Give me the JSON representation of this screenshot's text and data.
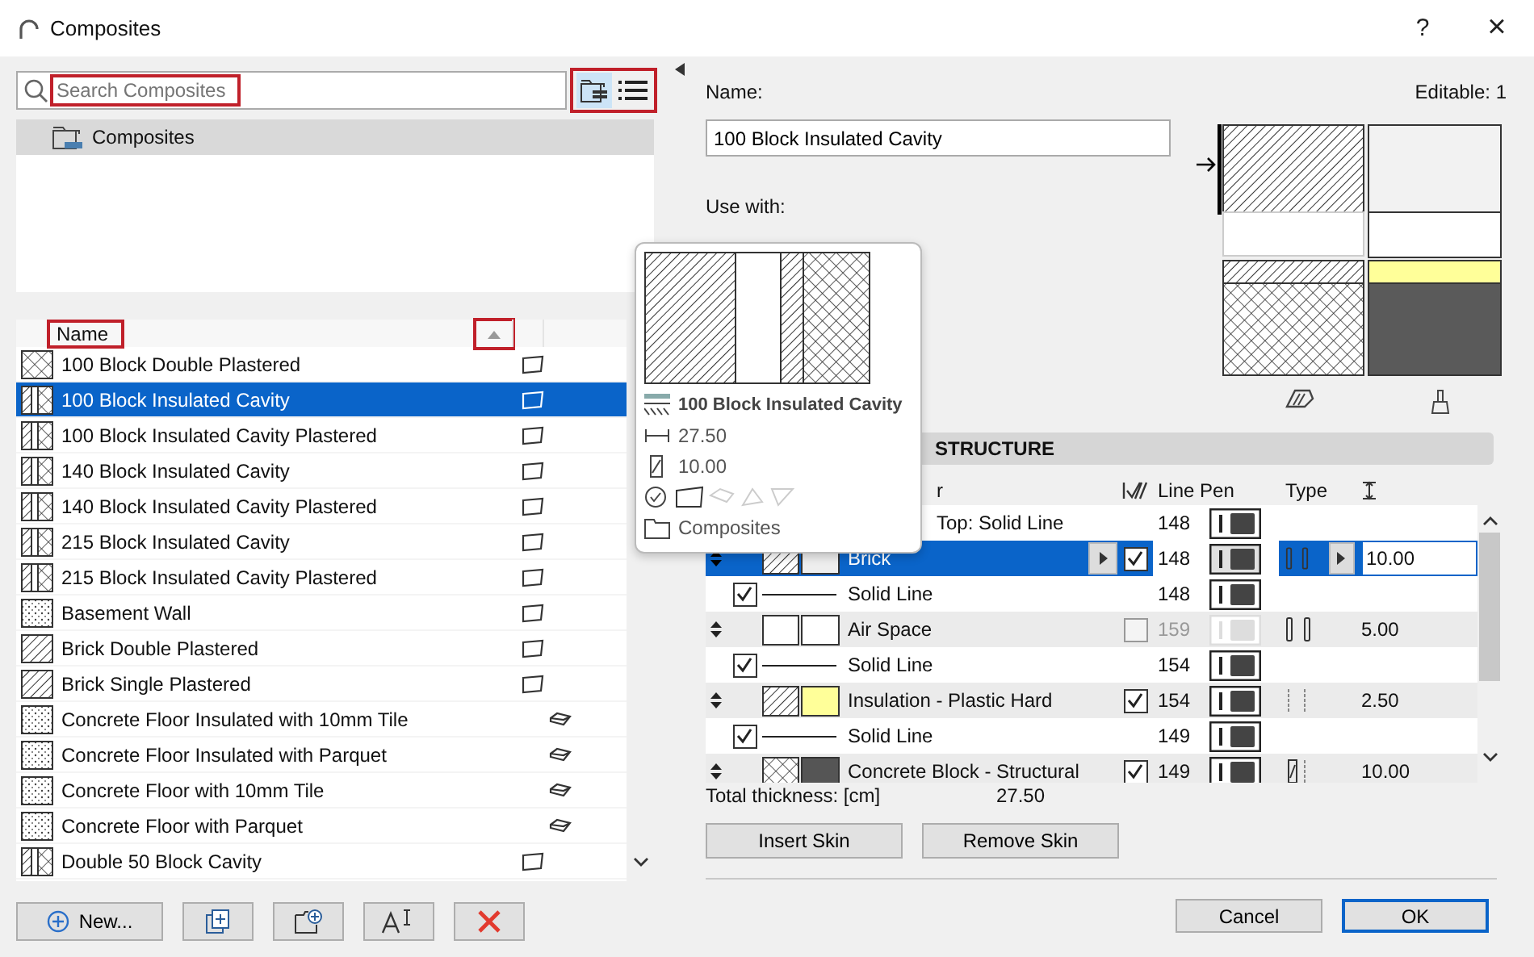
{
  "window": {
    "title": "Composites",
    "help": "?",
    "close": "×"
  },
  "search": {
    "placeholder": "Search Composites",
    "highlighted": true
  },
  "view_buttons": {
    "highlighted": true,
    "buttons": [
      {
        "kind": "folders",
        "selected": true
      },
      {
        "kind": "list",
        "selected": false
      }
    ]
  },
  "folder_tree": [
    {
      "label": "Composites",
      "selected": true
    }
  ],
  "list": {
    "name_header": {
      "label": "Name",
      "highlighted": true
    },
    "sort_button": {
      "highlighted": true
    },
    "rows": [
      {
        "name": "100 Block Double Plastered",
        "icon": {
          "kind": "cross"
        },
        "use": {
          "kind": "wall"
        },
        "selected": false
      },
      {
        "name": "100 Block Insulated Cavity",
        "icon": {
          "kind": "cavity"
        },
        "use": {
          "kind": "wall"
        },
        "selected": true
      },
      {
        "name": "100 Block Insulated Cavity Plastered",
        "icon": {
          "kind": "cavity"
        },
        "use": {
          "kind": "wall"
        },
        "selected": false
      },
      {
        "name": "140 Block Insulated Cavity",
        "icon": {
          "kind": "cavity"
        },
        "use": {
          "kind": "wall"
        },
        "selected": false
      },
      {
        "name": "140 Block Insulated Cavity Plastered",
        "icon": {
          "kind": "cavity"
        },
        "use": {
          "kind": "wall"
        },
        "selected": false
      },
      {
        "name": "215 Block Insulated Cavity",
        "icon": {
          "kind": "cavity"
        },
        "use": {
          "kind": "wall"
        },
        "selected": false
      },
      {
        "name": "215 Block Insulated Cavity Plastered",
        "icon": {
          "kind": "cavity"
        },
        "use": {
          "kind": "wall"
        },
        "selected": false
      },
      {
        "name": "Basement Wall",
        "icon": {
          "kind": "dots"
        },
        "use": {
          "kind": "wall"
        },
        "selected": false
      },
      {
        "name": "Brick Double Plastered",
        "icon": {
          "kind": "hatch"
        },
        "use": {
          "kind": "wall"
        },
        "selected": false
      },
      {
        "name": "Brick Single Plastered",
        "icon": {
          "kind": "hatch"
        },
        "use": {
          "kind": "wall"
        },
        "selected": false
      },
      {
        "name": "Concrete Floor Insulated with 10mm Tile",
        "icon": {
          "kind": "dots"
        },
        "use": {
          "kind": "floor"
        },
        "selected": false
      },
      {
        "name": "Concrete Floor Insulated with Parquet",
        "icon": {
          "kind": "dots"
        },
        "use": {
          "kind": "floor"
        },
        "selected": false
      },
      {
        "name": "Concrete Floor with 10mm Tile",
        "icon": {
          "kind": "dots"
        },
        "use": {
          "kind": "floor"
        },
        "selected": false
      },
      {
        "name": "Concrete Floor with Parquet",
        "icon": {
          "kind": "dots"
        },
        "use": {
          "kind": "floor"
        },
        "selected": false
      },
      {
        "name": "Double 50 Block Cavity",
        "icon": {
          "kind": "cavity"
        },
        "use": {
          "kind": "wall"
        },
        "selected": false
      }
    ]
  },
  "list_buttons": [
    {
      "kind": "new",
      "label": "New..."
    },
    {
      "kind": "duplicate"
    },
    {
      "kind": "folder"
    },
    {
      "kind": "rename"
    },
    {
      "kind": "delete"
    }
  ],
  "tooltip": {
    "name": "100 Block Insulated Cavity",
    "thickness": "27.50",
    "core": "10.00",
    "folder": "Composites"
  },
  "details": {
    "name_label": "Name:",
    "editable": "Editable: 1",
    "name_value": "100 Block Insulated Cavity",
    "use_with_label": "Use with:",
    "section": "STRUCTURE",
    "columns": [
      "r",
      "Line Pen",
      "Type"
    ],
    "rows": [
      {
        "kind": "line",
        "name": "Top: Solid Line",
        "pen": "148",
        "selected": false
      },
      {
        "kind": "skin",
        "name": "Brick",
        "pattern": {
          "kind": "hatch"
        },
        "color": "#eeeeee",
        "checked": true,
        "pen": "148",
        "layer_type": {
          "kind": "core"
        },
        "thickness": "10.00",
        "selected": true
      },
      {
        "kind": "line",
        "name": "Solid Line",
        "checked": true,
        "pen": "148",
        "selected": false
      },
      {
        "kind": "skin",
        "name": "Air Space",
        "pattern": {
          "kind": "empty"
        },
        "color": "#ffffff",
        "checked": false,
        "pen": "159",
        "layer_type": {
          "kind": "core"
        },
        "thickness": "5.00",
        "selected": false
      },
      {
        "kind": "line",
        "name": "Solid Line",
        "checked": true,
        "pen": "154",
        "selected": false
      },
      {
        "kind": "skin",
        "name": "Insulation - Plastic Hard",
        "pattern": {
          "kind": "hatch"
        },
        "color": "#ffff99",
        "checked": true,
        "pen": "154",
        "layer_type": {
          "kind": "finish"
        },
        "thickness": "2.50",
        "selected": false
      },
      {
        "kind": "line",
        "name": "Solid Line",
        "checked": true,
        "pen": "149",
        "selected": false
      },
      {
        "kind": "skin",
        "name": "Concrete Block - Structural",
        "pattern": {
          "kind": "cross"
        },
        "color": "#555555",
        "checked": true,
        "pen": "149",
        "layer_type": {
          "kind": "other"
        },
        "thickness": "10.00",
        "selected": false
      }
    ],
    "total_label": "Total thickness: [cm]",
    "total_value": "27.50",
    "buttons": [
      "Insert Skin",
      "Remove Skin"
    ]
  },
  "footer": [
    {
      "label": "Cancel",
      "default": false
    },
    {
      "label": "OK",
      "default": true
    }
  ]
}
